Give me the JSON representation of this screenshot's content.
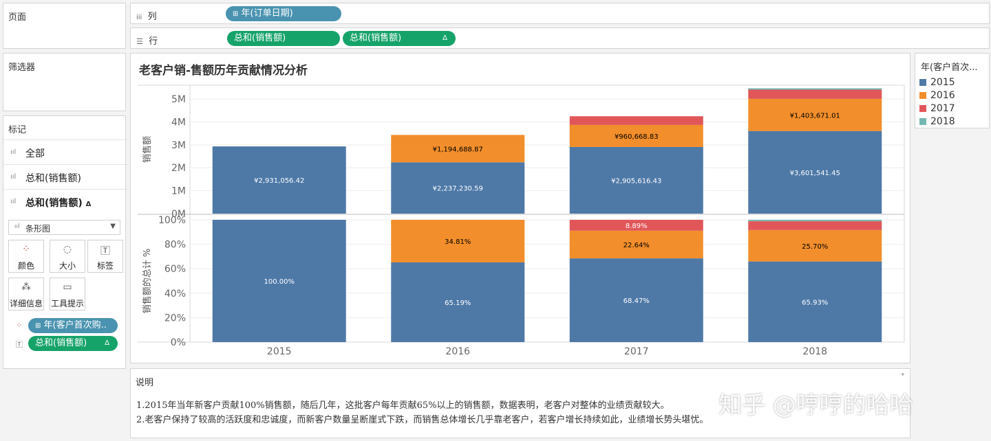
{
  "shelves": {
    "pages_label": "页面",
    "columns_label": "列",
    "rows_label": "行",
    "columns_pill": "年(订单日期)",
    "row_pill_1": "总和(销售额)",
    "row_pill_2": "总和(销售额)",
    "delta": "Δ"
  },
  "filters": {
    "title": "筛选器"
  },
  "marks": {
    "title": "标记",
    "rows": [
      {
        "label": "全部"
      },
      {
        "label": "总和(销售额)"
      },
      {
        "label": "总和(销售额)"
      }
    ],
    "delta": "Δ",
    "mark_type": "条形图",
    "buttons": [
      {
        "label": "颜色",
        "icon": "color-icon"
      },
      {
        "label": "大小",
        "icon": "size-icon"
      },
      {
        "label": "标签",
        "icon": "label-icon"
      },
      {
        "label": "详细信息",
        "icon": "detail-icon"
      },
      {
        "label": "工具提示",
        "icon": "tooltip-icon"
      }
    ],
    "pill_color": "年(客户首次购..",
    "pill_label": "总和(销售额)"
  },
  "legend": {
    "title": "年(客户首次...",
    "items": [
      {
        "label": "2015",
        "color": "#4e79a7"
      },
      {
        "label": "2016",
        "color": "#f28e2b"
      },
      {
        "label": "2017",
        "color": "#e15759"
      },
      {
        "label": "2018",
        "color": "#76b7b2"
      }
    ]
  },
  "notes": {
    "title": "说明",
    "line1": "1.2015年当年新客户贡献100%销售额，随后几年，这批客户每年贡献65%以上的销售额，数据表明，老客户对整体的业绩贡献较大。",
    "line2": "2.老客户保持了较高的活跃度和忠诚度，而新客户数量呈断崖式下跌，而销售总体增长几乎靠老客户，若客户增长持续如此，业绩增长势头堪忧。"
  },
  "watermark": "知乎 @哼哼的哈哈",
  "chart_data": [
    {
      "type": "bar",
      "stacked": true,
      "title": "老客户销-售额历年贡献情况分析",
      "ylabel": "销售额",
      "categories": [
        "2015",
        "2016",
        "2017",
        "2018"
      ],
      "ylim": [
        0,
        5600000
      ],
      "yticks": [
        "0M",
        "1M",
        "2M",
        "3M",
        "4M",
        "5M"
      ],
      "series": [
        {
          "name": "2015",
          "values": [
            2931056.42,
            2237230.59,
            2905616.43,
            3601541.45
          ],
          "labels": [
            "¥2,931,056.42",
            "¥2,237,230.59",
            "¥2,905,616.43",
            "¥3,601,541.45"
          ]
        },
        {
          "name": "2016",
          "values": [
            0,
            1194688.87,
            960668.83,
            1403671.01
          ],
          "labels": [
            "",
            "¥1,194,688.87",
            "¥960,668.83",
            "¥1,403,671.01"
          ]
        },
        {
          "name": "2017",
          "values": [
            0,
            0,
            380000,
            400000
          ],
          "labels": [
            "",
            "",
            "",
            ""
          ]
        },
        {
          "name": "2018",
          "values": [
            0,
            0,
            0,
            60000
          ],
          "labels": [
            "",
            "",
            "",
            ""
          ]
        }
      ]
    },
    {
      "type": "bar",
      "stacked": true,
      "ylabel": "销售额的总计 %",
      "categories": [
        "2015",
        "2016",
        "2017",
        "2018"
      ],
      "ylim": [
        0,
        100
      ],
      "yticks": [
        "0%",
        "20%",
        "40%",
        "60%",
        "80%",
        "100%"
      ],
      "series": [
        {
          "name": "2015",
          "values": [
            100,
            65.19,
            68.47,
            65.93
          ],
          "labels": [
            "100.00%",
            "65.19%",
            "68.47%",
            "65.93%"
          ]
        },
        {
          "name": "2016",
          "values": [
            0,
            34.81,
            22.64,
            25.7
          ],
          "labels": [
            "",
            "34.81%",
            "22.64%",
            "25.70%"
          ]
        },
        {
          "name": "2017",
          "values": [
            0,
            0,
            8.89,
            7.2
          ],
          "labels": [
            "",
            "",
            "8.89%",
            ""
          ]
        },
        {
          "name": "2018",
          "values": [
            0,
            0,
            0,
            1.17
          ],
          "labels": [
            "",
            "",
            "",
            ""
          ]
        }
      ]
    }
  ]
}
